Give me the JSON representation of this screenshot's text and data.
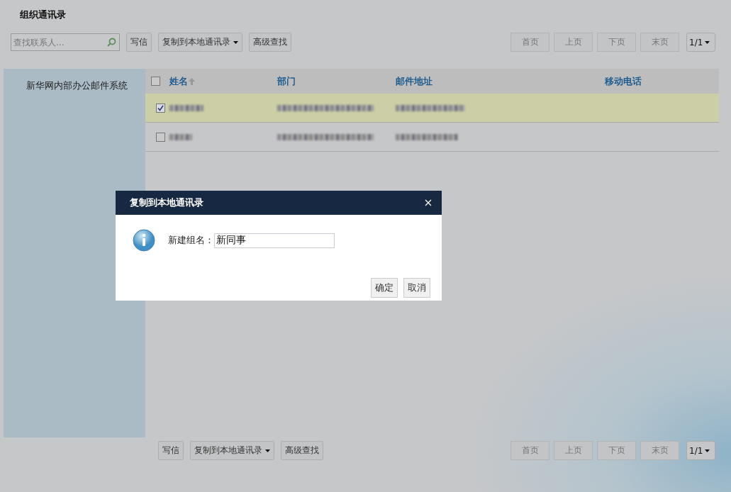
{
  "page_title": "组织通讯录",
  "toolbar": {
    "search": {
      "placeholder": "查找联系人..."
    },
    "buttons": [
      {
        "label": "写信",
        "dropdown": false
      },
      {
        "label": "复制到本地通讯录",
        "dropdown": true
      },
      {
        "label": "高级查找",
        "dropdown": false
      }
    ]
  },
  "pager": {
    "buttons": [
      "首页",
      "上页",
      "下页",
      "末页"
    ],
    "page_select": "1/1"
  },
  "sidebar": {
    "items": [
      {
        "label": "新华网内部办公邮件系统"
      }
    ]
  },
  "table": {
    "select_all": {
      "checked": false
    },
    "columns": [
      {
        "label": "姓名",
        "sorted": true
      },
      {
        "label": "部门",
        "sorted": false
      },
      {
        "label": "邮件地址",
        "sorted": false
      },
      {
        "label": "移动电话",
        "sorted": false
      }
    ],
    "rows": [
      {
        "selected": true
      },
      {
        "selected": false
      }
    ]
  },
  "bottom_toolbar": {
    "buttons": [
      {
        "label": "写信",
        "dropdown": false
      },
      {
        "label": "复制到本地通讯录",
        "dropdown": true
      },
      {
        "label": "高级查找",
        "dropdown": false
      }
    ]
  },
  "bottom_pager": {
    "buttons": [
      "首页",
      "上页",
      "下页",
      "末页"
    ],
    "page_select": "1/1"
  },
  "dialog": {
    "title": "复制到本地通讯录",
    "field_label": "新建组名：",
    "field_value": "新同事",
    "buttons": [
      "确定",
      "取消"
    ]
  }
}
